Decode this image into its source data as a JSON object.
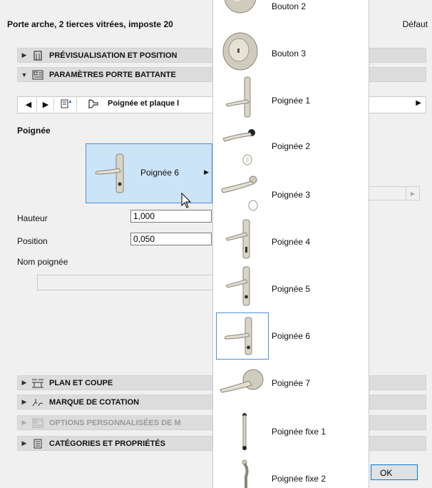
{
  "dialog": {
    "title": "Porte arche, 2 tierces vitrées, imposte 20",
    "default_label": "Défaut",
    "ok_label": "OK"
  },
  "sections": {
    "preview": "PRÉVISUALISATION ET POSITION",
    "door_params": "PARAMÈTRES PORTE BATTANTE",
    "plan_section": "PLAN ET COUPE",
    "dimension_marker": "MARQUE DE COTATION",
    "custom_options": "OPTIONS PERSONNALISÉES DE M",
    "categories": "CATÉGORIES ET PROPRIÉTÉS"
  },
  "nav": {
    "page_label": "Poignée et plaque l"
  },
  "handle_panel": {
    "heading": "Poignée",
    "selected_handle": "Poignée 6",
    "height_label": "Hauteur",
    "height_value": "1,000",
    "position_label": "Position",
    "position_value": "0,050",
    "name_label": "Nom poignée",
    "name_value": ""
  },
  "handle_list": {
    "items": [
      {
        "label": "Bouton 2",
        "icon": "knob-icon"
      },
      {
        "label": "Bouton 3",
        "icon": "knob-icon"
      },
      {
        "label": "Poignée 1",
        "icon": "lever-handle-icon"
      },
      {
        "label": "Poignée 2",
        "icon": "lever-handle-icon"
      },
      {
        "label": "Poignée 3",
        "icon": "lever-handle-icon"
      },
      {
        "label": "Poignée 4",
        "icon": "lever-handle-icon"
      },
      {
        "label": "Poignée 5",
        "icon": "lever-handle-icon"
      },
      {
        "label": "Poignée 6",
        "icon": "lever-handle-icon",
        "selected": true
      },
      {
        "label": "Poignée 7",
        "icon": "lever-handle-icon"
      },
      {
        "label": "Poignée fixe 1",
        "icon": "fixed-handle-icon"
      },
      {
        "label": "Poignée fixe 2",
        "icon": "fixed-handle-icon"
      }
    ]
  },
  "colors": {
    "selection_bg": "#cce4f7",
    "selection_border": "#4a90d9",
    "accent": "#0078d7"
  }
}
